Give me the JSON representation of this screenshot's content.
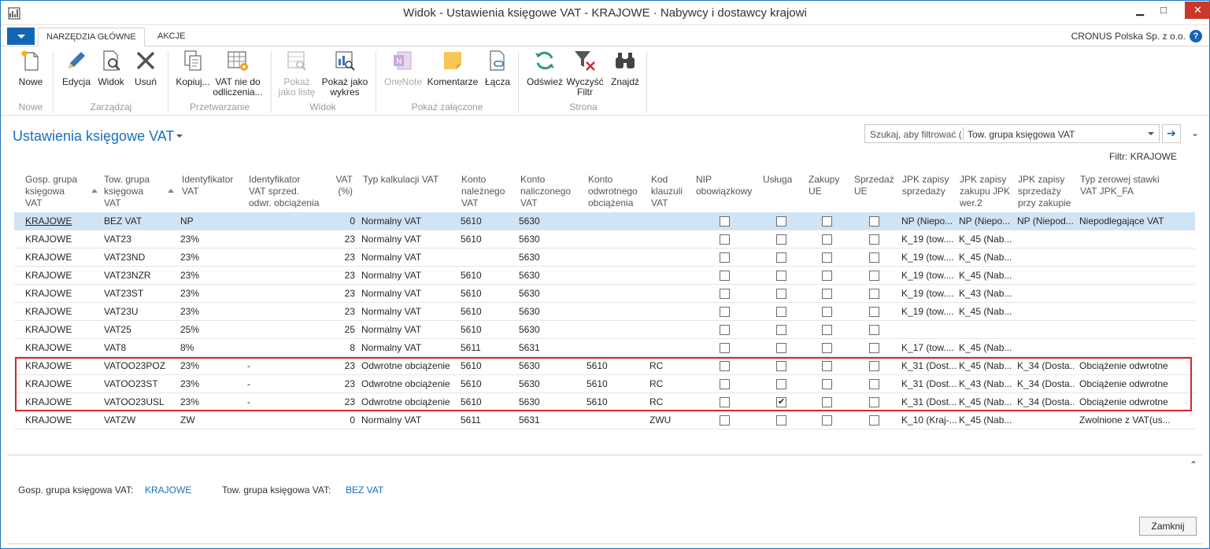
{
  "window": {
    "title": "Widok - Ustawienia księgowe VAT - KRAJOWE · Nabywcy i dostawcy krajowi",
    "minimize": "▁",
    "maximize": "□",
    "close": "✕"
  },
  "tabs": {
    "home": "NARZĘDZIA GŁÓWNE",
    "actions": "AKCJE"
  },
  "company": "CRONUS Polska Sp. z o.o.",
  "help": "?",
  "ribbon": {
    "new": "Nowe",
    "edit": "Edycja",
    "view": "Widok",
    "delete": "Usuń",
    "copy": "Kopiuj...",
    "vat_non_deduct_line1": "VAT nie do",
    "vat_non_deduct_line2": "odliczenia...",
    "show_list_line1": "Pokaż",
    "show_list_line2": "jako listę",
    "show_chart_line1": "Pokaż jako",
    "show_chart_line2": "wykres",
    "onenote": "OneNote",
    "comments": "Komentarze",
    "links": "Łącza",
    "refresh": "Odśwież",
    "clear_filter_line1": "Wyczyść",
    "clear_filter_line2": "Filtr",
    "find": "Znajdź",
    "groups": {
      "new": "Nowe",
      "manage": "Zarządzaj",
      "process": "Przetwarzanie",
      "view": "Widok",
      "attachments": "Pokaż załączone",
      "page": "Strona"
    }
  },
  "page": {
    "title": "Ustawienia księgowe VAT",
    "search_placeholder": "Szukaj, aby filtrować (...",
    "search_field": "Tow. grupa księgowa VAT",
    "go": "➔",
    "collapse": "⌄",
    "filter": "Filtr: KRAJOWE"
  },
  "columns": {
    "c1": [
      "Gosp. grupa",
      "księgowa",
      "VAT"
    ],
    "c2": [
      "Tow. grupa",
      "księgowa",
      "VAT"
    ],
    "c3": [
      "Identyfikator",
      "VAT"
    ],
    "c4": [
      "Identyfikator",
      "VAT sprzed.",
      "odwr. obciążenia"
    ],
    "c5": [
      "VAT",
      "(%)"
    ],
    "c6": [
      "Typ kalkulacji VAT"
    ],
    "c7": [
      "Konto",
      "należnego",
      "VAT"
    ],
    "c8": [
      "Konto",
      "naliczonego",
      "VAT"
    ],
    "c9": [
      "Konto",
      "odwrotnego",
      "obciążenia"
    ],
    "c10": [
      "Kod",
      "klauzuli",
      "VAT"
    ],
    "c11": [
      "NIP",
      "obowiązkowy"
    ],
    "c12": [
      "Usługa"
    ],
    "c13": [
      "Zakupy",
      "UE"
    ],
    "c14": [
      "Sprzedaż",
      "UE"
    ],
    "c15": [
      "JPK zapisy",
      "sprzedaży"
    ],
    "c16": [
      "JPK zapisy",
      "zakupu JPK",
      "wer.2"
    ],
    "c17": [
      "JPK zapisy",
      "sprzedaży",
      "przy zakupie"
    ],
    "c18": [
      "Typ zerowej stawki",
      "VAT  JPK_FA"
    ]
  },
  "rows": [
    {
      "bus": "KRAJOWE",
      "prod": "BEZ VAT",
      "id": "NP",
      "rev": "",
      "pct": "0",
      "calc": "Normalny VAT",
      "sale": "5610",
      "purch": "5630",
      "revacc": "",
      "clause": "",
      "nip": false,
      "service": false,
      "eu_purch": false,
      "eu_sale": false,
      "jpk_s": "NP (Niepo...",
      "jpk_p": "NP (Niepo...",
      "jpk_sp": "NP (Niepod...",
      "zero": "Niepodlegające VAT"
    },
    {
      "bus": "KRAJOWE",
      "prod": "VAT23",
      "id": "23%",
      "rev": "",
      "pct": "23",
      "calc": "Normalny VAT",
      "sale": "5610",
      "purch": "5630",
      "revacc": "",
      "clause": "",
      "nip": false,
      "service": false,
      "eu_purch": false,
      "eu_sale": false,
      "jpk_s": "K_19 (tow....",
      "jpk_p": "K_45 (Nab...",
      "jpk_sp": "",
      "zero": ""
    },
    {
      "bus": "KRAJOWE",
      "prod": "VAT23ND",
      "id": "23%",
      "rev": "",
      "pct": "23",
      "calc": "Normalny VAT",
      "sale": "",
      "purch": "5630",
      "revacc": "",
      "clause": "",
      "nip": false,
      "service": false,
      "eu_purch": false,
      "eu_sale": false,
      "jpk_s": "K_19 (tow....",
      "jpk_p": "K_45 (Nab...",
      "jpk_sp": "",
      "zero": ""
    },
    {
      "bus": "KRAJOWE",
      "prod": "VAT23NZR",
      "id": "23%",
      "rev": "",
      "pct": "23",
      "calc": "Normalny VAT",
      "sale": "5610",
      "purch": "5630",
      "revacc": "",
      "clause": "",
      "nip": false,
      "service": false,
      "eu_purch": false,
      "eu_sale": false,
      "jpk_s": "K_19 (tow....",
      "jpk_p": "K_45 (Nab...",
      "jpk_sp": "",
      "zero": ""
    },
    {
      "bus": "KRAJOWE",
      "prod": "VAT23ST",
      "id": "23%",
      "rev": "",
      "pct": "23",
      "calc": "Normalny VAT",
      "sale": "5610",
      "purch": "5630",
      "revacc": "",
      "clause": "",
      "nip": false,
      "service": false,
      "eu_purch": false,
      "eu_sale": false,
      "jpk_s": "K_19 (tow....",
      "jpk_p": "K_43 (Nab...",
      "jpk_sp": "",
      "zero": ""
    },
    {
      "bus": "KRAJOWE",
      "prod": "VAT23U",
      "id": "23%",
      "rev": "",
      "pct": "23",
      "calc": "Normalny VAT",
      "sale": "5610",
      "purch": "5630",
      "revacc": "",
      "clause": "",
      "nip": false,
      "service": false,
      "eu_purch": false,
      "eu_sale": false,
      "jpk_s": "K_19 (tow....",
      "jpk_p": "K_45 (Nab...",
      "jpk_sp": "",
      "zero": ""
    },
    {
      "bus": "KRAJOWE",
      "prod": "VAT25",
      "id": "25%",
      "rev": "",
      "pct": "25",
      "calc": "Normalny VAT",
      "sale": "5610",
      "purch": "5630",
      "revacc": "",
      "clause": "",
      "nip": false,
      "service": false,
      "eu_purch": false,
      "eu_sale": false,
      "jpk_s": "",
      "jpk_p": "",
      "jpk_sp": "",
      "zero": ""
    },
    {
      "bus": "KRAJOWE",
      "prod": "VAT8",
      "id": "8%",
      "rev": "",
      "pct": "8",
      "calc": "Normalny VAT",
      "sale": "5611",
      "purch": "5631",
      "revacc": "",
      "clause": "",
      "nip": false,
      "service": false,
      "eu_purch": false,
      "eu_sale": false,
      "jpk_s": "K_17 (tow....",
      "jpk_p": "K_45 (Nab...",
      "jpk_sp": "",
      "zero": ""
    },
    {
      "bus": "KRAJOWE",
      "prod": "VATOO23POZ",
      "id": "23%",
      "rev": "-",
      "pct": "23",
      "calc": "Odwrotne obciążenie",
      "sale": "5610",
      "purch": "5630",
      "revacc": "5610",
      "clause": "RC",
      "nip": false,
      "service": false,
      "eu_purch": false,
      "eu_sale": false,
      "jpk_s": "K_31 (Dost...",
      "jpk_p": "K_45 (Nab...",
      "jpk_sp": "K_34 (Dosta...",
      "zero": "Obciążenie odwrotne"
    },
    {
      "bus": "KRAJOWE",
      "prod": "VATOO23ST",
      "id": "23%",
      "rev": "-",
      "pct": "23",
      "calc": "Odwrotne obciążenie",
      "sale": "5610",
      "purch": "5630",
      "revacc": "5610",
      "clause": "RC",
      "nip": false,
      "service": false,
      "eu_purch": false,
      "eu_sale": false,
      "jpk_s": "K_31 (Dost...",
      "jpk_p": "K_43 (Nab...",
      "jpk_sp": "K_34 (Dosta...",
      "zero": "Obciążenie odwrotne"
    },
    {
      "bus": "KRAJOWE",
      "prod": "VATOO23USL",
      "id": "23%",
      "rev": "-",
      "pct": "23",
      "calc": "Odwrotne obciążenie",
      "sale": "5610",
      "purch": "5630",
      "revacc": "5610",
      "clause": "RC",
      "nip": false,
      "service": true,
      "eu_purch": false,
      "eu_sale": false,
      "jpk_s": "K_31 (Dost...",
      "jpk_p": "K_45 (Nab...",
      "jpk_sp": "K_34 (Dosta...",
      "zero": "Obciążenie odwrotne"
    },
    {
      "bus": "KRAJOWE",
      "prod": "VATZW",
      "id": "ZW",
      "rev": "",
      "pct": "0",
      "calc": "Normalny VAT",
      "sale": "5611",
      "purch": "5631",
      "revacc": "",
      "clause": "ZWU",
      "nip": false,
      "service": false,
      "eu_purch": false,
      "eu_sale": false,
      "jpk_s": "K_10 (Kraj-...",
      "jpk_p": "K_45 (Nab...",
      "jpk_sp": "",
      "zero": "Zwolnione z VAT(us..."
    }
  ],
  "factbox": {
    "chevron": "⌃",
    "bus_label": "Gosp. grupa księgowa VAT:",
    "bus_value": "KRAJOWE",
    "prod_label": "Tow. grupa księgowa VAT:",
    "prod_value": "BEZ VAT"
  },
  "close_label": "Zamknij",
  "colors": {
    "accent": "#1a6fbe",
    "selection": "#cfe4f5",
    "highlight": "#d6262d"
  }
}
